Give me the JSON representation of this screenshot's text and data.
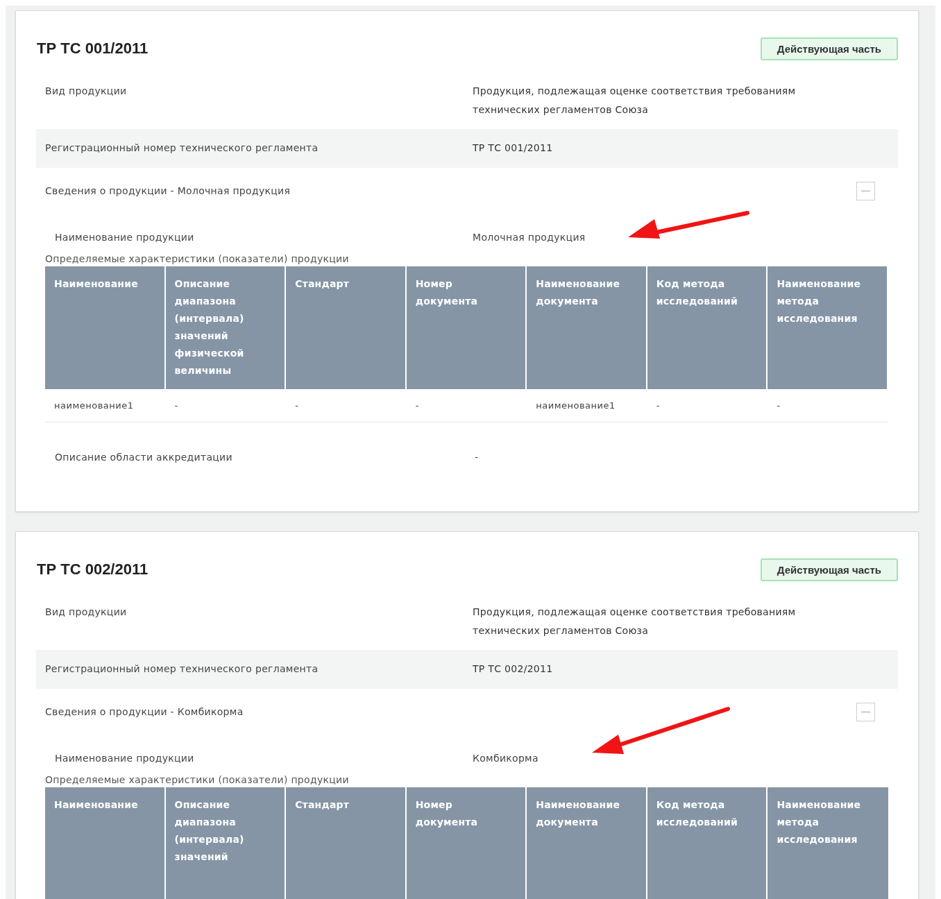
{
  "sections": [
    {
      "title": "ТР ТС 001/2011",
      "badge": "Действующая часть",
      "fields": [
        {
          "label": "Вид продукции",
          "value": "Продукция, подлежащая оценке соответствия требованиям технических регламентов Союза"
        },
        {
          "label": "Регистрационный номер технического регламента",
          "value": "ТР ТС 001/2011"
        }
      ],
      "product": {
        "heading": "Сведения о продукции - Молочная продукция",
        "expanded": true,
        "name_label": "Наименование продукции",
        "name_value": "Молочная продукция",
        "characteristics_title": "Определяемые характеристики (показатели) продукции",
        "columns": [
          "Наименование",
          "Описание диапазона (интервала) значений физической величины",
          "Стандарт",
          "Номер документа",
          "Наименование документа",
          "Код метода исследований",
          "Наименование метода исследования"
        ],
        "rows": [
          [
            "наименование1",
            "-",
            "-",
            "-",
            "наименование1",
            "-",
            "-"
          ]
        ],
        "footer": {
          "label": "Описание области аккредитации",
          "value": "-"
        }
      }
    },
    {
      "title": "ТР ТС 002/2011",
      "badge": "Действующая часть",
      "fields": [
        {
          "label": "Вид продукции",
          "value": "Продукция, подлежащая оценке соответствия требованиям технических регламентов Союза"
        },
        {
          "label": "Регистрационный номер технического регламента",
          "value": "ТР ТС 002/2011"
        }
      ],
      "product": {
        "heading": "Сведения о продукции - Комбикорма",
        "expanded": true,
        "name_label": "Наименование продукции",
        "name_value": "Комбикорма",
        "characteristics_title": "Определяемые характеристики (показатели) продукции",
        "columns": [
          "Наименование",
          "Описание диапазона (интервала) значений",
          "Стандарт",
          "Номер документа",
          "Наименование документа",
          "Код метода исследований",
          "Наименование метода исследования"
        ]
      }
    }
  ]
}
